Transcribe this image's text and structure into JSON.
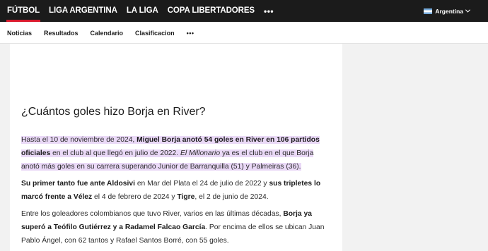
{
  "topnav": {
    "items": [
      "FÚTBOL",
      "LIGA ARGENTINA",
      "LA LIGA",
      "COPA LIBERTADORES"
    ],
    "more": "•••",
    "region": "Argentina"
  },
  "subnav": {
    "items": [
      "Noticias",
      "Resultados",
      "Calendario",
      "Clasificacion"
    ],
    "more": "•••"
  },
  "article": {
    "heading": "¿Cuántos goles hizo Borja en River?",
    "p1": {
      "t1": "Hasta el 10 de noviembre de 2024, ",
      "b1": "Miguel Borja anotó 54 goles en River en 106 partidos oficiales",
      "t2": " en el club al que llegó en julio de 2022. ",
      "i1": "El Millonario",
      "t3": " ya es el  club en el que Borja anotó más goles en su carrera superando Junior de Barranquilla (51) y Palmeiras (36)."
    },
    "p2": {
      "b1": "Su primer tanto fue ante Aldosivi",
      "t1": " en Mar del Plata el 24 de julio de 2022 y ",
      "b2": "sus tripletes lo marcó frente a Vélez",
      "t2": " el 4 de febrero de 2024 y ",
      "b3": "Tigre",
      "t3": ", el 2 de junio de 2024."
    },
    "p3": {
      "t1": "Entre los goleadores colombianos que tuvo River, varios en las últimas décadas, ",
      "b1": "Borja ya superó a Teófilo Gutiérrez y a Radamel Falcao García",
      "t2": ". Por encima de ellos se ubican Juan Pablo Ángel, con 62 tantos y Rafael Santos Borré, con 55 goles."
    }
  }
}
